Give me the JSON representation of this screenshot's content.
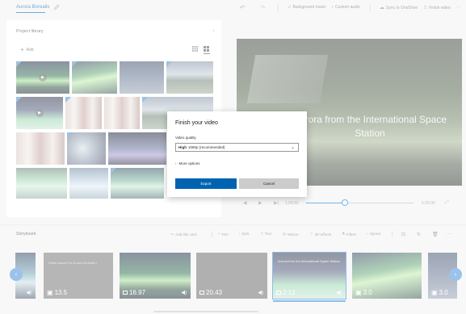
{
  "topbar": {
    "project_title": "Aurora Borealis",
    "actions": [
      {
        "icon": "music-icon",
        "label": "Background music"
      },
      {
        "icon": "custom-audio-icon",
        "label": "Custom audio"
      },
      {
        "icon": "onedrive-icon",
        "label": "Sync to OneDrive"
      },
      {
        "icon": "share-icon",
        "label": "Finish video"
      }
    ],
    "more": "···"
  },
  "library": {
    "title": "Project library",
    "add_label": "Add"
  },
  "preview": {
    "caption": "Aurora from the International Space Station"
  },
  "playback": {
    "current_time": "1:58.80",
    "total_time": "5:26.00",
    "progress": 0.36
  },
  "storyboard": {
    "title": "Storyboard",
    "tools": [
      {
        "icon": "title-card-icon",
        "label": "Add title card"
      },
      {
        "icon": "trim-icon",
        "label": "Trim"
      },
      {
        "icon": "split-icon",
        "label": "Split"
      },
      {
        "icon": "text-icon",
        "label": "Text"
      },
      {
        "icon": "motion-icon",
        "label": "Motion"
      },
      {
        "icon": "3d-effects-icon",
        "label": "3D effects"
      },
      {
        "icon": "filters-icon",
        "label": "Filters"
      },
      {
        "icon": "speed-icon",
        "label": "Speed"
      }
    ],
    "cards": [
      {
        "duration": "",
        "text": ""
      },
      {
        "duration": "13.5",
        "text": "What causes the Aurora Borealis?"
      },
      {
        "duration": "16.97",
        "text": ""
      },
      {
        "duration": "20.43",
        "text": ""
      },
      {
        "duration": "2:12",
        "text": "Aurora from the International Space Station"
      },
      {
        "duration": "3.0",
        "text": ""
      },
      {
        "duration": "3.0",
        "text": ""
      }
    ]
  },
  "dialog": {
    "title": "Finish your video",
    "quality_label": "Video quality",
    "quality_value_bold": "High",
    "quality_value_rest": "1080p (recommended)",
    "more_options": "More options",
    "export_label": "Export",
    "cancel_label": "Cancel"
  },
  "colors": {
    "accent": "#0063b1",
    "selection": "#2d89d8"
  }
}
